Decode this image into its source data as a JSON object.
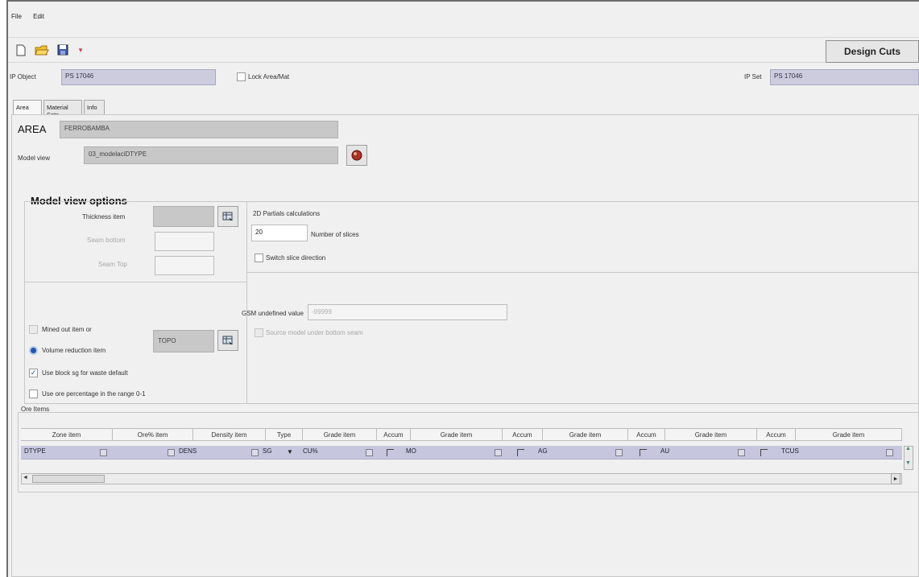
{
  "menu": {
    "file": "File",
    "edit": "Edit"
  },
  "toolbar": {
    "design_cuts": "Design Cuts"
  },
  "header": {
    "ip_object_label": "IP Object",
    "ip_object_value": "PS 17046",
    "lock_label": "Lock Area/Mat",
    "ip_set_label": "IP Set",
    "ip_set_value": "PS 17046"
  },
  "tabs": [
    "Area",
    "Material Sets",
    "Info"
  ],
  "area": {
    "label": "AREA",
    "value": "FERROBAMBA",
    "model_view_label": "Model view",
    "model_view_value": "03_modelaciDTYPE"
  },
  "options": {
    "title": "Model view options",
    "thickness_label": "Thickness item",
    "seam_bottom_label": "Seam bottom",
    "seam_top_label": "Seam Top",
    "calc_title": "2D Partials calculations",
    "slices_value": "20",
    "slices_label": "Number of slices",
    "switch_label": "Switch slice direction",
    "gsm_label": "GSM undefined value",
    "gsm_value": "-99999",
    "gsm_check_label": "Source model under bottom seam",
    "mined_label": "Mined out item or",
    "volume_label": "Volume reduction item",
    "volume_value": "TOPO",
    "use_block_label": "Use block sg for waste default",
    "use_ore_label": "Use ore percentage in the range 0-1"
  },
  "ore_items": {
    "title": "Ore Items",
    "headers": [
      "Zone item",
      "Ore% item",
      "Density item",
      "Type",
      "Grade item",
      "Accum",
      "Grade item",
      "Accum",
      "Grade item",
      "Accum",
      "Grade item",
      "Accum",
      "Grade item"
    ],
    "row": [
      "DTYPE",
      "",
      "DENS",
      "SG",
      "CU%",
      "",
      "MO",
      "",
      "AG",
      "",
      "AU",
      "",
      "TCUS"
    ]
  }
}
